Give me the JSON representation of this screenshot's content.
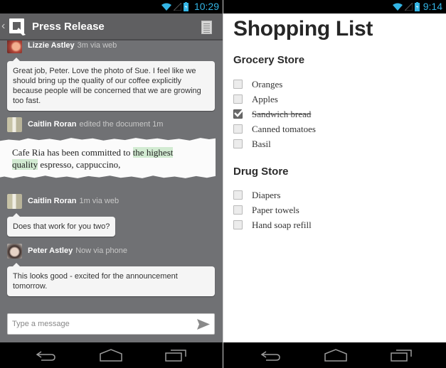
{
  "left_app": {
    "status_bar": {
      "time": "10:29"
    },
    "action_bar": {
      "back_glyph": "‹",
      "title": "Press Release",
      "icons": [
        "app-logo-icon",
        "document-icon"
      ]
    },
    "feed": [
      {
        "type": "comment",
        "author": "Lizzie Astley",
        "meta": "3m via web",
        "text": "Great job, Peter. Love the photo of Sue. I feel like we should bring up the quality of our coffee explicitly because people will be concerned that we are growing too fast."
      },
      {
        "type": "edit",
        "author": "Caitlin Roran",
        "meta": "edited the document 1m",
        "excerpt_before": "Cafe Ria has been committed to ",
        "excerpt_highlight_1": "the highest",
        "excerpt_highlight_2": "quality",
        "excerpt_after": " espresso, cappuccino,"
      },
      {
        "type": "comment",
        "author": "Caitlin Roran",
        "meta": "1m via web",
        "text": "Does that work for you two?"
      },
      {
        "type": "comment",
        "author": "Peter Astley",
        "meta": "Now via phone",
        "text": "This looks good - excited for the announcement tomorrow."
      }
    ],
    "compose": {
      "placeholder": "Type a message",
      "value": ""
    },
    "colors": {
      "background": "#707174",
      "action_bar": "#5f5f61",
      "status_accent": "#33b5e5",
      "highlight": "#d2ebd2"
    }
  },
  "right_app": {
    "status_bar": {
      "time": "9:14"
    },
    "title": "Shopping List",
    "sections": [
      {
        "title": "Grocery Store",
        "items": [
          {
            "label": "Oranges",
            "checked": false
          },
          {
            "label": "Apples",
            "checked": false
          },
          {
            "label": "Sandwich bread",
            "checked": true
          },
          {
            "label": "Canned tomatoes",
            "checked": false
          },
          {
            "label": "Basil",
            "checked": false
          }
        ]
      },
      {
        "title": "Drug Store",
        "items": [
          {
            "label": "Diapers",
            "checked": false
          },
          {
            "label": "Paper towels",
            "checked": false
          },
          {
            "label": "Hand soap refill",
            "checked": false
          }
        ]
      }
    ]
  },
  "nav_bar": {
    "buttons": [
      "back-icon",
      "home-icon",
      "recents-icon"
    ]
  }
}
